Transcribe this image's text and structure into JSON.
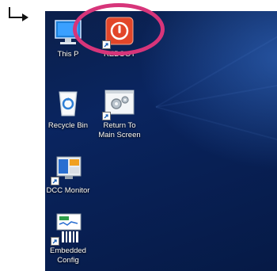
{
  "icons": {
    "this_pc": {
      "label": "This P",
      "icon": "computer-monitor-icon"
    },
    "reboot": {
      "label": "REBOOT",
      "icon": "power-icon"
    },
    "recycle_bin": {
      "label": "Recycle Bin",
      "icon": "recycle-bin-icon"
    },
    "return_main": {
      "label_line1": "Return To",
      "label_line2": "Main Screen",
      "icon": "gears-icon"
    },
    "dcc_monitor": {
      "label": "DCC Monitor",
      "icon": "dcc-monitor-icon"
    },
    "embedded_config": {
      "label_line1": "Embedded",
      "label_line2": "Config",
      "icon": "embedded-config-icon"
    }
  },
  "colors": {
    "highlight": "#d7357a",
    "reboot_red": "#e2462a"
  }
}
